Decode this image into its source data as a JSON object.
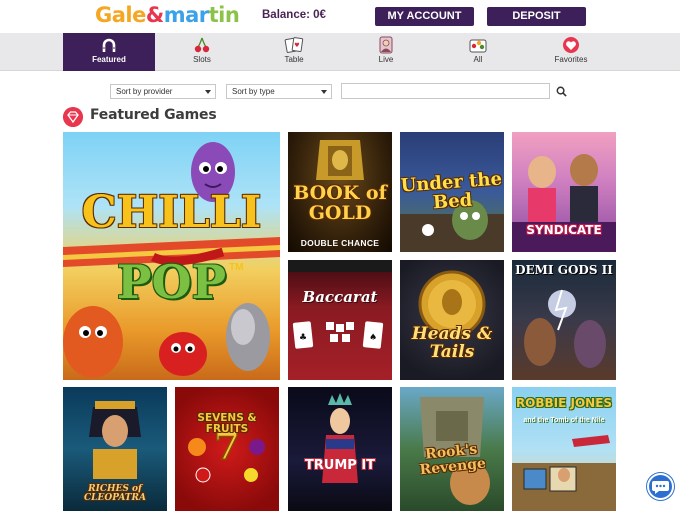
{
  "header": {
    "logo_text": "Gale&Martin",
    "balance": "Balance: 0€",
    "my_account": "MY ACCOUNT",
    "deposit": "DEPOSIT"
  },
  "nav": {
    "items": [
      {
        "label": "Featured",
        "icon": "horseshoe-icon",
        "active": true
      },
      {
        "label": "Slots",
        "icon": "cherries-icon",
        "active": false
      },
      {
        "label": "Table",
        "icon": "playing-cards-icon",
        "active": false
      },
      {
        "label": "Live",
        "icon": "live-dealer-icon",
        "active": false
      },
      {
        "label": "All",
        "icon": "all-games-icon",
        "active": false
      },
      {
        "label": "Favorites",
        "icon": "heart-icon",
        "active": false
      }
    ]
  },
  "filters": {
    "provider_label": "Sort by provider",
    "type_label": "Sort by type",
    "search_value": ""
  },
  "section": {
    "title": "Featured Games"
  },
  "games": [
    {
      "title": "CHILLI",
      "subtitle": "POP",
      "tm": "TM"
    },
    {
      "title": "BOOK of GOLD",
      "subtitle": "DOUBLE CHANCE"
    },
    {
      "title": "Under the Bed"
    },
    {
      "title": "SYNDICATE"
    },
    {
      "title": "Baccarat"
    },
    {
      "title": "Heads & Tails"
    },
    {
      "title": "DEMI GODS II"
    },
    {
      "title": "RICHES of CLEOPATRA"
    },
    {
      "title": "SEVENS & FRUITS"
    },
    {
      "title": "TRUMP IT"
    },
    {
      "title": "Rook's Revenge"
    },
    {
      "title": "ROBBIE JONES",
      "subtitle": "and the Tomb of the Nile"
    }
  ],
  "colors": {
    "brand_purple": "#3d1f59",
    "accent_red": "#e8364f",
    "chat_blue": "#2d6fd1"
  }
}
